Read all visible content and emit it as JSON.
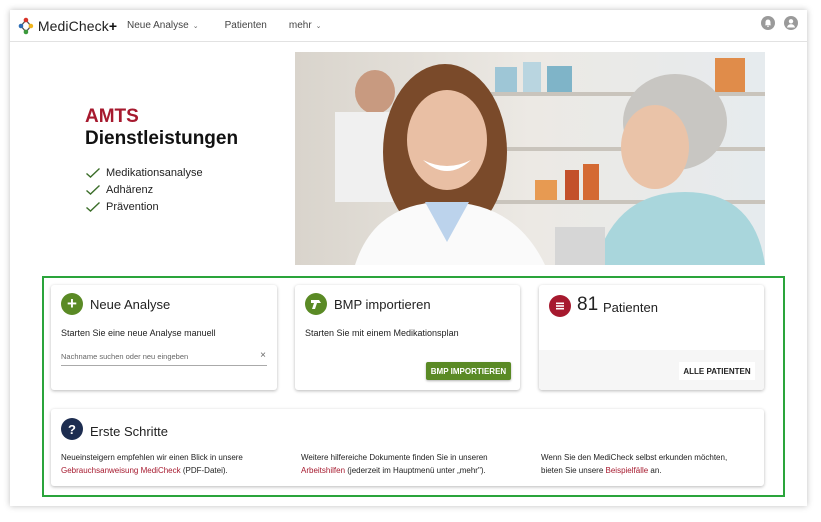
{
  "nav": {
    "logo_text": "MediCheck",
    "logo_plus": "+",
    "items": [
      {
        "label": "Neue Analyse",
        "dropdown": true
      },
      {
        "label": "Patienten",
        "dropdown": false
      },
      {
        "label": "mehr",
        "dropdown": true
      }
    ],
    "icons": [
      "bell-icon",
      "user-account-icon"
    ]
  },
  "hero": {
    "title_line1": "AMTS",
    "title_line2": "Dienstleistungen",
    "checklist": [
      "Medikationsanalyse",
      "Adhärenz",
      "Prävention"
    ],
    "image": "pharmacist-and-customer-photo"
  },
  "cards": {
    "neue_analyse": {
      "title": "Neue Analyse",
      "text": "Starten Sie eine neue Analyse manuell",
      "search_placeholder": "Nachname suchen oder neu eingeben",
      "clear": "×",
      "icon": "plus-icon"
    },
    "bmp": {
      "title": "BMP importieren",
      "text": "Starten Sie mit einem Medikationsplan",
      "button": "BMP IMPORTIEREN",
      "icon": "barcode-scanner-icon"
    },
    "patienten": {
      "count": "81",
      "title": "Patienten",
      "button": "ALLE PATIENTEN",
      "icon": "list-icon"
    },
    "erste_schritte": {
      "title": "Erste Schritte",
      "icon": "question-icon",
      "col1_text1": "Neueinsteigern empfehlen wir einen Blick in unsere",
      "col1_link": "Gebrauchsanweisung MediCheck",
      "col1_text2": " (PDF-Datei).",
      "col2_text1": "Weitere hilfereiche Dokumente finden Sie in unseren",
      "col2_link": "Arbeitshilfen",
      "col2_text2": " (jederzeit im Hauptmenü unter „mehr\").",
      "col3_text1": "Wenn Sie den MediCheck selbst erkunden möchten,",
      "col3_text2a": "bieten Sie unsere ",
      "col3_link": "Beispielfälle",
      "col3_text2b": " an."
    }
  },
  "colors": {
    "brand_red": "#a6192e",
    "green": "#5a8a25",
    "highlight_green": "#2aa43b",
    "navy": "#1d2d50"
  }
}
